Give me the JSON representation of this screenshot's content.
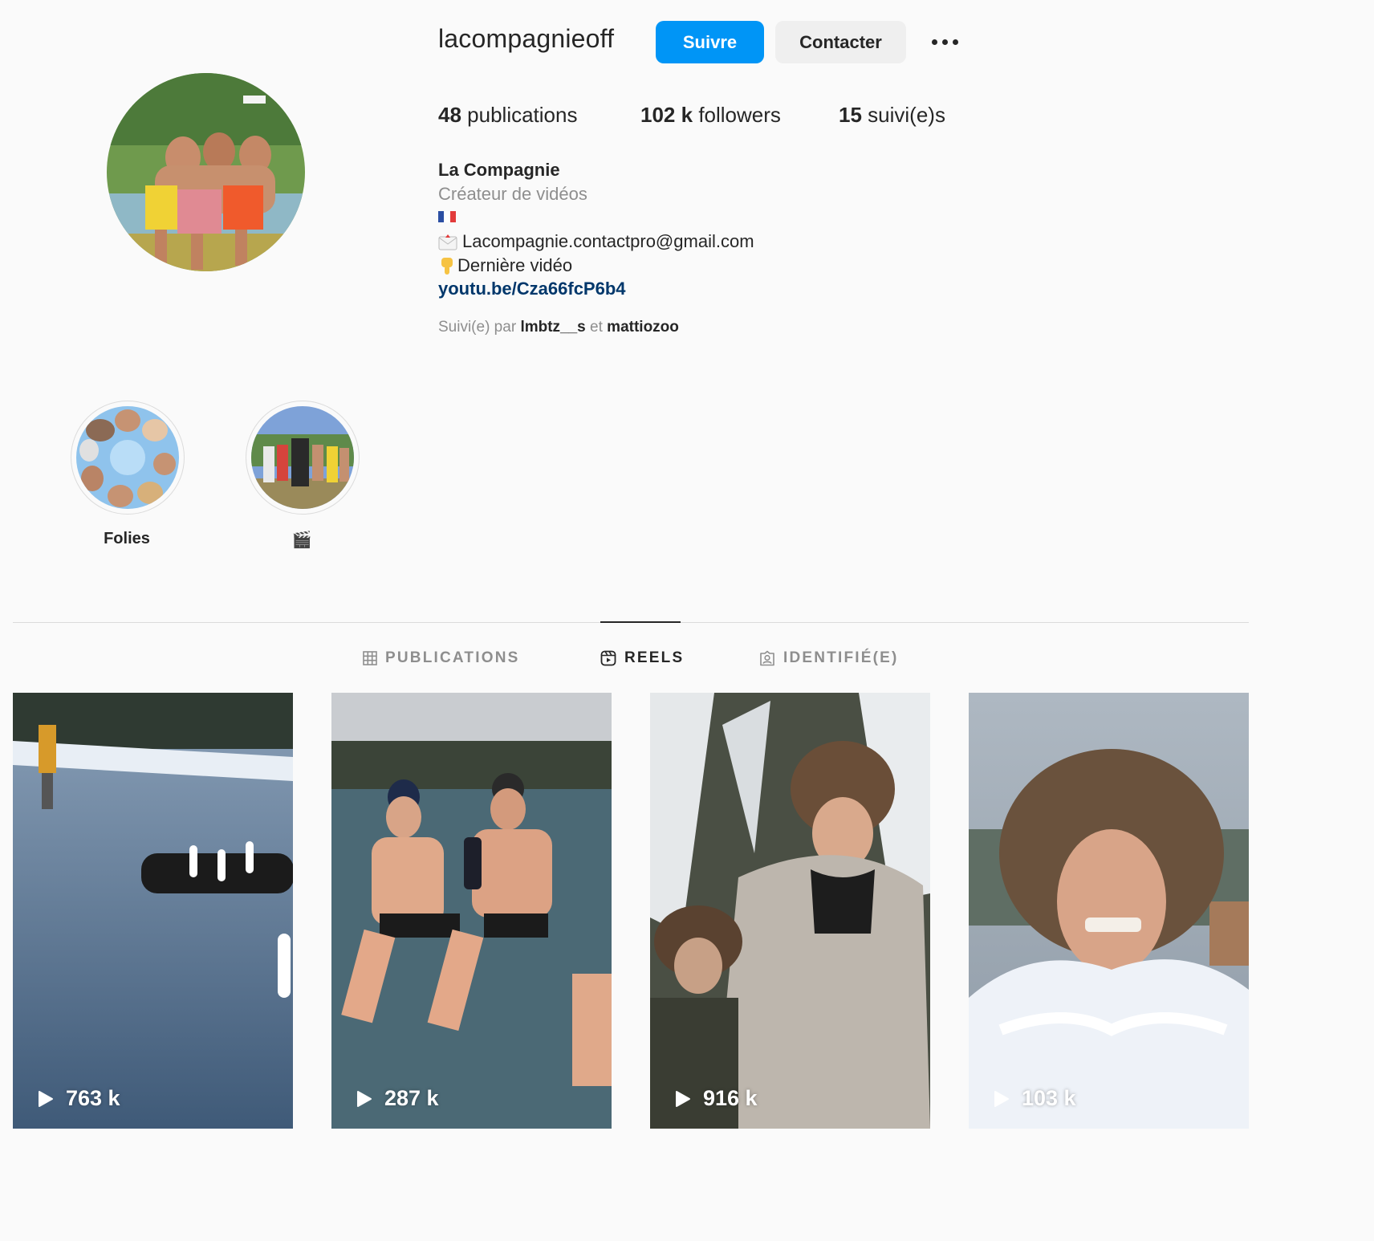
{
  "profile": {
    "username": "lacompagnieoff",
    "follow_label": "Suivre",
    "contact_label": "Contacter"
  },
  "stats": {
    "posts_count": "48",
    "posts_label": "publications",
    "followers_count": "102 k",
    "followers_label": "followers",
    "following_count": "15",
    "following_label": "suivi(e)s"
  },
  "bio": {
    "name": "La Compagnie",
    "category": "Créateur de vidéos",
    "email_line": "Lacompagnie.contactpro@gmail.com",
    "video_line": "Dernière vidéo",
    "link": "youtu.be/Cza66fcP6b4",
    "followed_prefix": "Suivi(e) par",
    "followed_user_1": "lmbtz__s",
    "followed_joiner": "et",
    "followed_user_2": "mattiozoo"
  },
  "highlights": [
    {
      "label": "Folies"
    },
    {
      "label": "🎬"
    }
  ],
  "tabs": [
    {
      "label": "PUBLICATIONS",
      "icon": "grid-icon",
      "active": false
    },
    {
      "label": "REELS",
      "icon": "reels-icon",
      "active": true
    },
    {
      "label": "IDENTIFIÉ(E)",
      "icon": "tagged-icon",
      "active": false
    }
  ],
  "reels": [
    {
      "views": "763 k"
    },
    {
      "views": "287 k"
    },
    {
      "views": "916 k"
    },
    {
      "views": "103 k"
    }
  ],
  "colors": {
    "accent": "#0095f6",
    "link": "#00376b",
    "muted": "#8e8e8e",
    "background": "#fafafa"
  }
}
